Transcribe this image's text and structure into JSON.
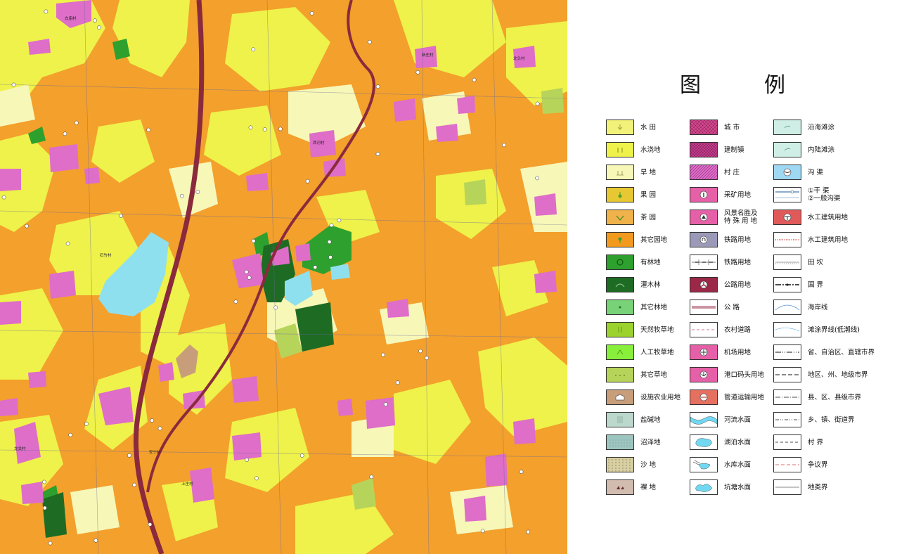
{
  "legend": {
    "title_chars": [
      "图",
      "例"
    ],
    "col1": [
      {
        "label": "水  田",
        "icon": "paddy-field",
        "color": "#f2f27a"
      },
      {
        "label": "水浇地",
        "icon": "irrigated-land",
        "color": "#eef24a"
      },
      {
        "label": "旱  地",
        "icon": "dry-land",
        "color": "#f7f7b8"
      },
      {
        "label": "果  园",
        "icon": "orchard",
        "color": "#e8c832"
      },
      {
        "label": "茶  园",
        "icon": "tea-garden",
        "color": "#f0b24a"
      },
      {
        "label": "其它园地",
        "icon": "other-garden",
        "color": "#f29a1e"
      },
      {
        "label": "有林地",
        "icon": "forest",
        "color": "#2ea02e"
      },
      {
        "label": "灌木林",
        "icon": "shrub-forest",
        "color": "#1e6b24"
      },
      {
        "label": "其它林地",
        "icon": "other-forest",
        "color": "#78d278"
      },
      {
        "label": "天然牧草地",
        "icon": "natural-grassland",
        "color": "#9bd22e"
      },
      {
        "label": "人工牧草地",
        "icon": "artificial-grassland",
        "color": "#88f03a"
      },
      {
        "label": "其它草地",
        "icon": "other-grassland",
        "color": "#b7d45a"
      },
      {
        "label": "设施农业用地",
        "icon": "facility-agriculture",
        "color": "#c89e7a"
      },
      {
        "label": "盐碱地",
        "icon": "saline-land",
        "color": "#bcd8cc"
      },
      {
        "label": "沼泽地",
        "icon": "swamp",
        "color": "#9ec6c0"
      },
      {
        "label": "沙  地",
        "icon": "sand",
        "color": "#d8cfa2"
      },
      {
        "label": "裸  地",
        "icon": "bare-land",
        "color": "#d2bcb0"
      }
    ],
    "col2": [
      {
        "label": "城  市",
        "icon": "city",
        "color": "#d0468c"
      },
      {
        "label": "建制镇",
        "icon": "town",
        "color": "#c43c8c"
      },
      {
        "label": "村  庄",
        "icon": "village",
        "color": "#de6ec8"
      },
      {
        "label": "采矿用地",
        "icon": "mining",
        "color": "#e660a8"
      },
      {
        "label": "风景名胜及\n特 殊 用 地",
        "icon": "scenic-special",
        "color": "#e660a8"
      },
      {
        "label": "铁路用地",
        "icon": "railway-land",
        "color": "#9a9ab8"
      },
      {
        "label": "铁路用地",
        "icon": "railway-line",
        "color": "#ffffff"
      },
      {
        "label": "公路用地",
        "icon": "highway-land",
        "color": "#9a2846"
      },
      {
        "label": "公  路",
        "icon": "highway",
        "color": "#ffffff"
      },
      {
        "label": "农村道路",
        "icon": "rural-road",
        "color": "#ffffff"
      },
      {
        "label": "机场用地",
        "icon": "airport",
        "color": "#e660a8"
      },
      {
        "label": "港口码头用地",
        "icon": "port",
        "color": "#e660a8"
      },
      {
        "label": "管道运输用地",
        "icon": "pipeline",
        "color": "#e67060"
      },
      {
        "label": "河流水面",
        "icon": "river",
        "color": "#72d8f2"
      },
      {
        "label": "湖泊水面",
        "icon": "lake",
        "color": "#72d8f2"
      },
      {
        "label": "水库水面",
        "icon": "reservoir",
        "color": "#72d8f2"
      },
      {
        "label": "坑塘水面",
        "icon": "pond",
        "color": "#72d8f2"
      }
    ],
    "col3": [
      {
        "label": "沿海滩涂",
        "icon": "coastal-tidal-flat",
        "color": "#cfeee6"
      },
      {
        "label": "内陆滩涂",
        "icon": "inland-tidal-flat",
        "color": "#cfeee6"
      },
      {
        "label": "沟  渠",
        "icon": "ditch",
        "color": "#9ed8f2"
      },
      {
        "label": "①干  渠\n②一般沟渠",
        "icon": "canal",
        "color": "#ffffff"
      },
      {
        "label": "水工建筑用地",
        "icon": "hydraulic-land",
        "color": "#e05a5a"
      },
      {
        "label": "水工建筑用地",
        "icon": "hydraulic-line",
        "color": "#ffffff"
      },
      {
        "label": "田  坎",
        "icon": "ridge",
        "color": "#ffffff"
      },
      {
        "label": "国  界",
        "icon": "national-border",
        "color": "#ffffff"
      },
      {
        "label": "海岸线",
        "icon": "coastline",
        "color": "#ffffff"
      },
      {
        "label": "滩涂界线(低潮线)",
        "icon": "low-tide-line",
        "color": "#ffffff"
      },
      {
        "label": "省、自治区、直辖市界",
        "icon": "province-border",
        "color": "#ffffff"
      },
      {
        "label": "地区、州、地级市界",
        "icon": "prefecture-border",
        "color": "#ffffff"
      },
      {
        "label": "县、区、县级市界",
        "icon": "county-border",
        "color": "#ffffff"
      },
      {
        "label": "乡、镇、街道界",
        "icon": "township-border",
        "color": "#ffffff"
      },
      {
        "label": "村  界",
        "icon": "village-border",
        "color": "#ffffff"
      },
      {
        "label": "争议界",
        "icon": "disputed-border",
        "color": "#ffffff"
      },
      {
        "label": "地类界",
        "icon": "landclass-border",
        "color": "#ffffff"
      }
    ]
  },
  "map": {
    "colors": {
      "orange": "#f3a02c",
      "yellow": "#eef24a",
      "pale": "#f7f7b8",
      "village": "#de6ec8",
      "green": "#2ea02e",
      "dark_green": "#1e6b24",
      "light_green": "#b7d45a",
      "water": "#8fe0ee",
      "highway": "#8a2a3c"
    },
    "place_labels": [
      "白庙村",
      "上庄村",
      "龙关村",
      "石竹村",
      "新庄村",
      "西河村",
      "安宁村",
      "北头村"
    ]
  }
}
